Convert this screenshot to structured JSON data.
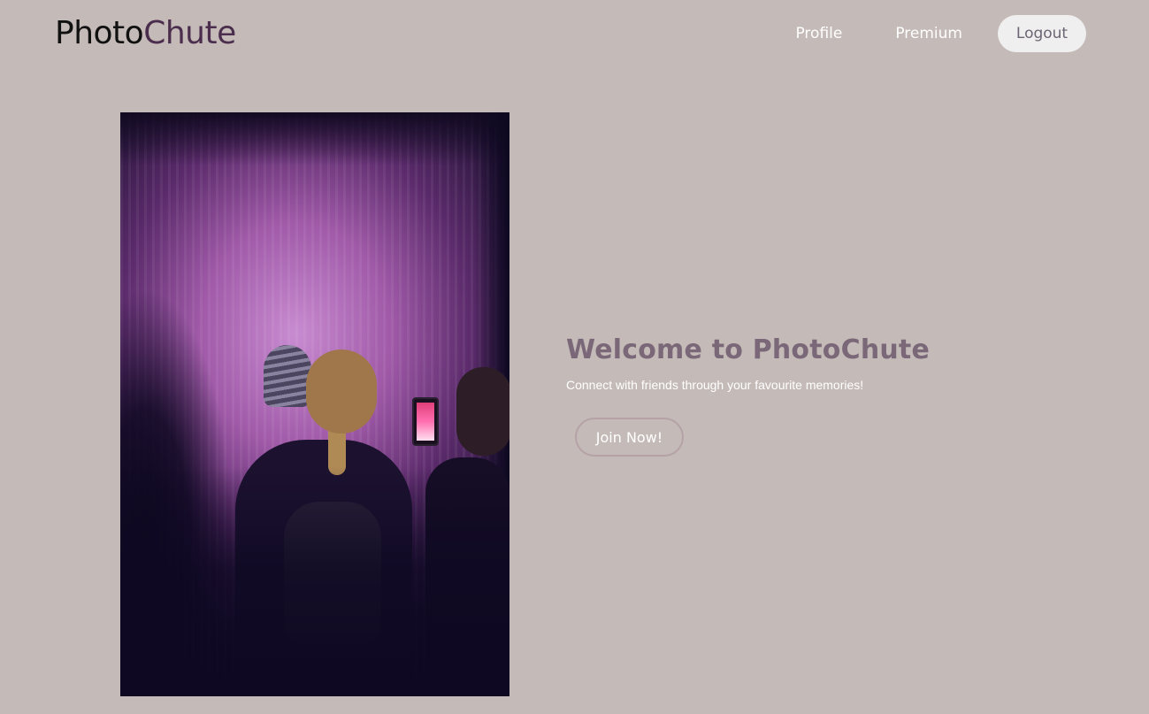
{
  "header": {
    "logo_part1": "Photo",
    "logo_part2": "Chute",
    "nav": {
      "profile": "Profile",
      "premium": "Premium",
      "logout": "Logout"
    }
  },
  "hero": {
    "title": "Welcome to PhotoChute",
    "subtitle": "Connect with friends through your favourite memories!",
    "cta_label": "Join Now!"
  },
  "colors": {
    "background": "#c4bab7",
    "logo_accent": "#4b2e4d",
    "title_text": "#7a6878"
  }
}
